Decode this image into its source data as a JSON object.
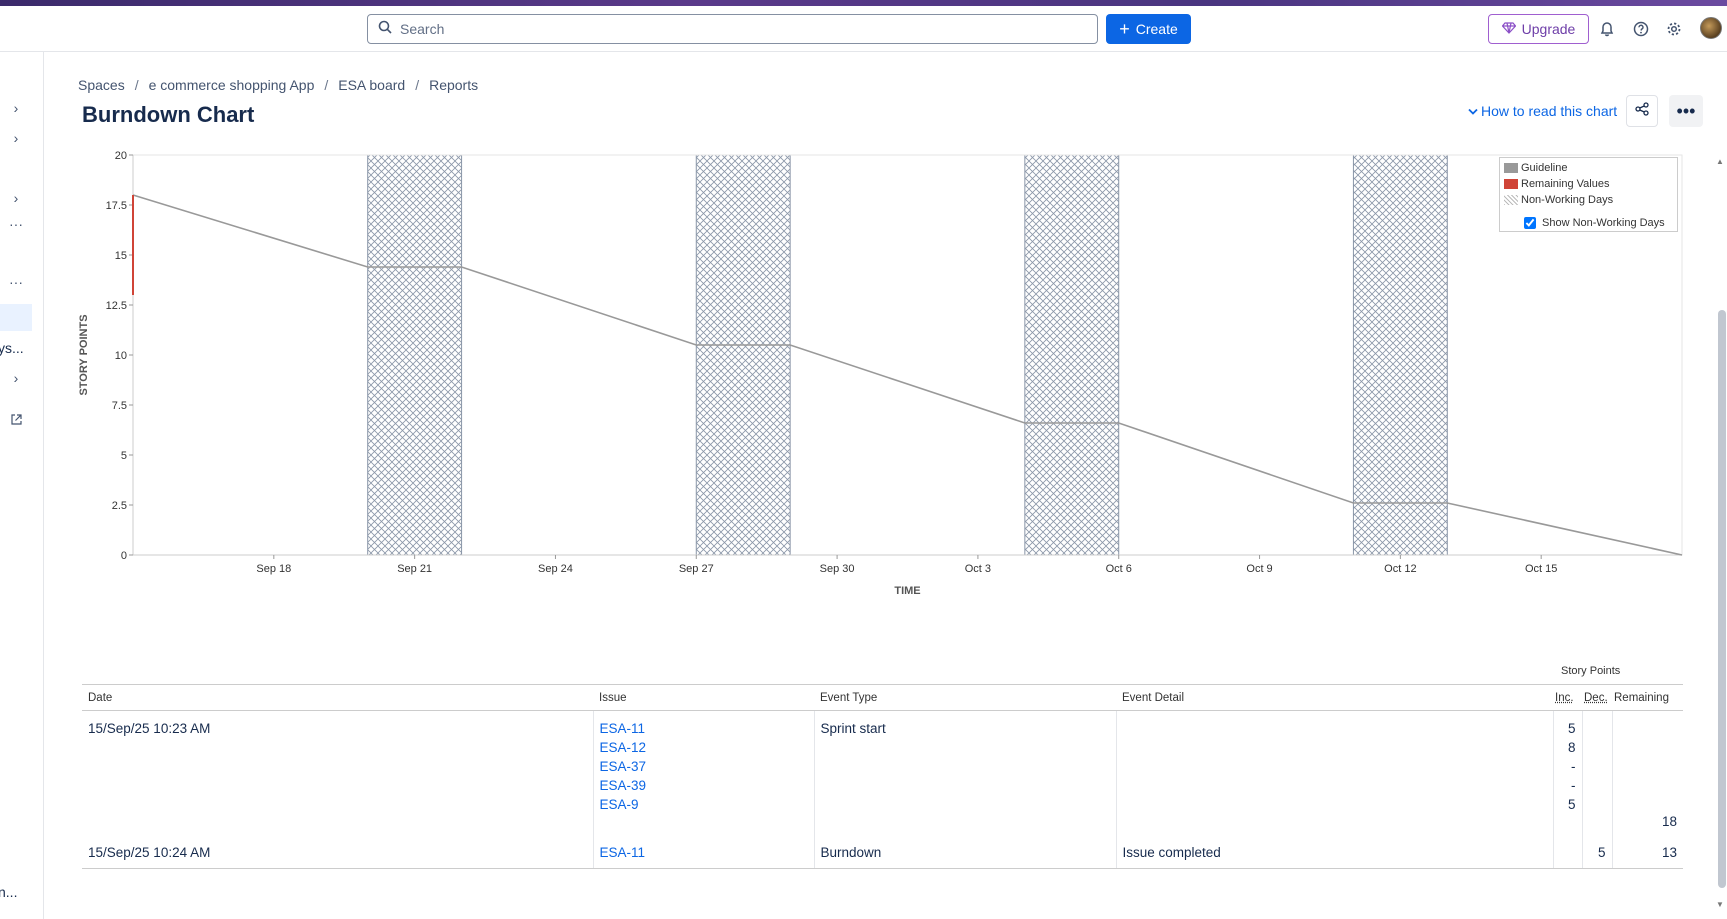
{
  "topbar": {
    "search_placeholder": "Search",
    "create_label": "Create",
    "upgrade_label": "Upgrade",
    "icons": [
      "search-icon",
      "plus-icon",
      "diamond-icon",
      "bell-icon",
      "help-icon",
      "gear-icon"
    ]
  },
  "sidebar": {
    "truncated_labels": [
      "ys...",
      "n..."
    ]
  },
  "breadcrumb": [
    "Spaces",
    "e commerce shopping App",
    "ESA board",
    "Reports"
  ],
  "page": {
    "title": "Burndown Chart",
    "how_to_label": "How to read this chart"
  },
  "legend": {
    "guideline": "Guideline",
    "remaining": "Remaining Values",
    "non_working": "Non-Working Days",
    "show_non_working": "Show Non-Working Days",
    "show_non_working_checked": true
  },
  "chart_data": {
    "type": "line",
    "xlabel": "TIME",
    "ylabel": "STORY POINTS",
    "ylim": [
      0,
      20
    ],
    "y_ticks": [
      "0",
      "2.5",
      "5",
      "7.5",
      "10",
      "12.5",
      "15",
      "17.5",
      "20"
    ],
    "x_ticks": [
      "Sep 18",
      "Sep 21",
      "Sep 24",
      "Sep 27",
      "Sep 30",
      "Oct 3",
      "Oct 6",
      "Oct 9",
      "Oct 12",
      "Oct 15"
    ],
    "x_range": [
      "Sep 15",
      "Oct 18"
    ],
    "series": [
      {
        "name": "Guideline",
        "color": "#999999",
        "points": [
          [
            "Sep 15",
            18
          ],
          [
            "Sep 20",
            14.4
          ],
          [
            "Sep 22",
            14.4
          ],
          [
            "Sep 27",
            10.5
          ],
          [
            "Sep 29",
            10.5
          ],
          [
            "Oct 4",
            6.6
          ],
          [
            "Oct 6",
            6.6
          ],
          [
            "Oct 11",
            2.6
          ],
          [
            "Oct 13",
            2.6
          ],
          [
            "Oct 18",
            0
          ]
        ]
      },
      {
        "name": "Remaining Values",
        "color": "#d04437",
        "points": [
          [
            "Sep 15",
            18
          ],
          [
            "Sep 15",
            13
          ]
        ]
      }
    ],
    "non_working_periods": [
      [
        "Sep 20",
        "Sep 22"
      ],
      [
        "Sep 27",
        "Sep 29"
      ],
      [
        "Oct 4",
        "Oct 6"
      ],
      [
        "Oct 11",
        "Oct 13"
      ]
    ],
    "grid": false,
    "legend_position": "top-right"
  },
  "table": {
    "story_points_header": "Story Points",
    "headers": {
      "date": "Date",
      "issue": "Issue",
      "event_type": "Event Type",
      "event_detail": "Event Detail",
      "inc": "Inc.",
      "dec": "Dec.",
      "remaining": "Remaining"
    },
    "rows": [
      {
        "date": "15/Sep/25 10:23 AM",
        "issues": [
          "ESA-11",
          "ESA-12",
          "ESA-37",
          "ESA-39",
          "ESA-9"
        ],
        "event_type": "Sprint start",
        "event_detail": "",
        "inc": [
          "5",
          "8",
          "-",
          "-",
          "5"
        ],
        "dec": "",
        "remaining": "18"
      },
      {
        "date": "15/Sep/25 10:24 AM",
        "issues": [
          "ESA-11"
        ],
        "event_type": "Burndown",
        "event_detail": "Issue completed",
        "inc": [],
        "dec": "5",
        "remaining": "13"
      }
    ]
  }
}
